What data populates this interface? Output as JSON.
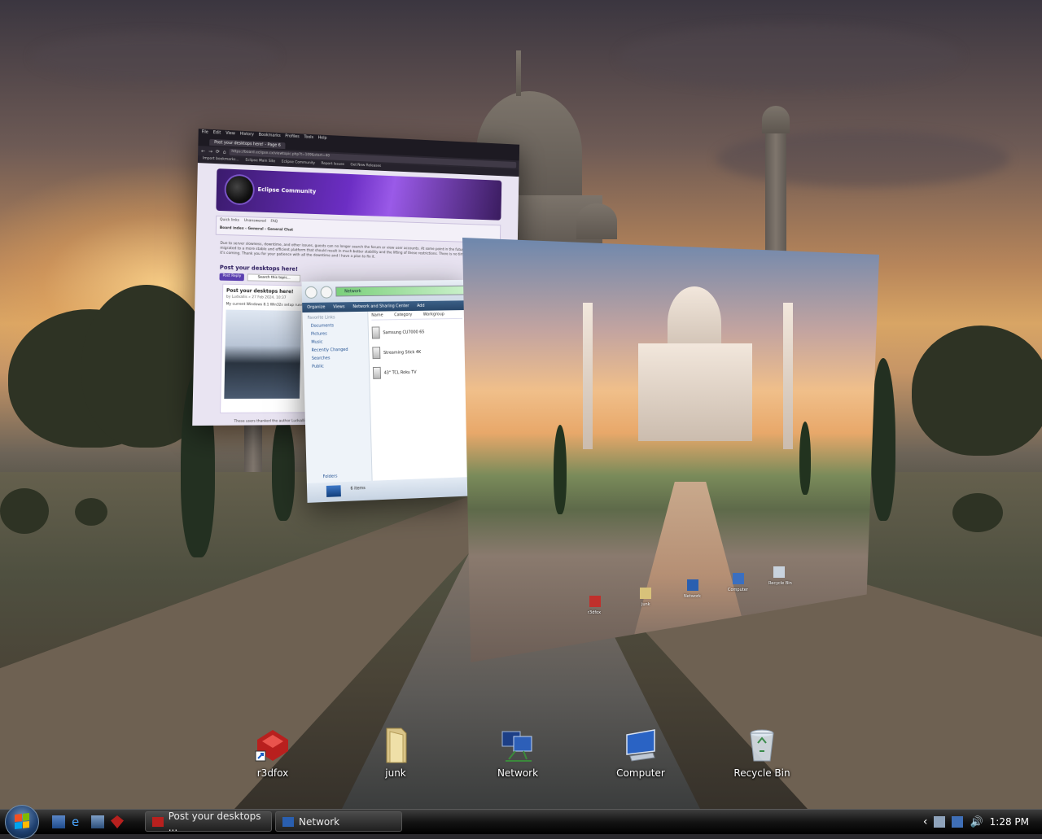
{
  "browser": {
    "menu": [
      "File",
      "Edit",
      "View",
      "History",
      "Bookmarks",
      "Profiles",
      "Tools",
      "Help"
    ],
    "tab_title": "Post your desktops here! - Page 6",
    "url": "https://board.eclipse.cx/viewtopic.php?t=109&start=40",
    "bookmarks": [
      "Import bookmarks...",
      "Eclipse Main Site",
      "Eclipse Community",
      "Report Issues",
      "Get New Releases"
    ],
    "forum_title": "Eclipse Community",
    "nav_links": [
      "Quick links",
      "Unanswered",
      "FAQ"
    ],
    "breadcrumb": "Board index ‹ General ‹ General Chat",
    "notice": "Due to server slowness, downtime, and other issues, guests can no longer search the forum or view user accounts. At some point in the future, Eclipse will be migrated to a more stable and efficient platform that should result in much better stability and the lifting of these restrictions. There is no timeline for this yet, but it's coming. Thank you for your patience with all the downtime and I have a plan to fix it.",
    "topic_title": "Post your desktops here!",
    "post_reply": "Post Reply",
    "search_placeholder": "Search this topic...",
    "post_title": "Post your desktops here!",
    "post_meta": "by Ludvallis » 27 Feb 2024, 10:37",
    "post_body": "My current Windows 8.1 Win32s setup running. Bring it online my 1 year newer laptop seems...",
    "post_footer": "These users thanked the author Ludvallis for the post"
  },
  "explorer": {
    "address": "Network",
    "toolbar": [
      "Organize",
      "Views",
      "Network and Sharing Center",
      "Add"
    ],
    "favorite_links_header": "Favorite Links",
    "favorites": [
      "Documents",
      "Pictures",
      "Music",
      "Recently Changed",
      "Searches",
      "Public"
    ],
    "columns": [
      "Name",
      "Category",
      "Workgroup"
    ],
    "items": [
      "Samsung CU7000 65",
      "Streaming Stick 4K",
      "43\" TCL Roku TV"
    ],
    "folders_label": "Folders",
    "status": "6 items"
  },
  "photo_icons": [
    "r3dfox",
    "junk",
    "Network",
    "Computer",
    "Recycle Bin"
  ],
  "desktop_icons": [
    {
      "label": "r3dfox"
    },
    {
      "label": "junk"
    },
    {
      "label": "Network"
    },
    {
      "label": "Computer"
    },
    {
      "label": "Recycle Bin"
    }
  ],
  "taskbar": {
    "buttons": [
      "Post your desktops ...",
      "Network"
    ],
    "clock": "1:28 PM"
  }
}
